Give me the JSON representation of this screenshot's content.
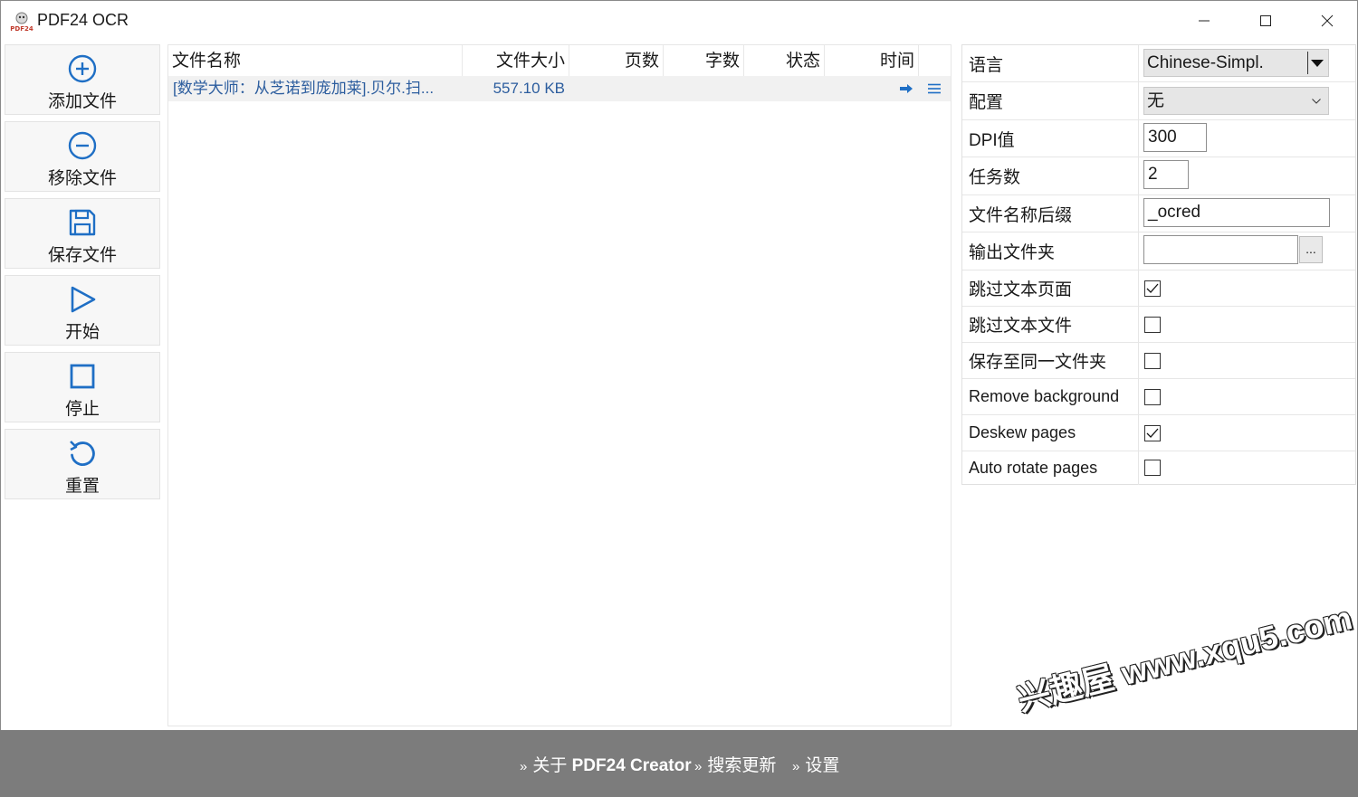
{
  "app": {
    "title": "PDF24 OCR"
  },
  "toolbar": {
    "add": "添加文件",
    "remove": "移除文件",
    "save": "保存文件",
    "start": "开始",
    "stop": "停止",
    "reset": "重置"
  },
  "filelist": {
    "columns": [
      "文件名称",
      "文件大小",
      "页数",
      "字数",
      "状态",
      "时间"
    ],
    "rows": [
      {
        "name": "[数学大师：从芝诺到庞加莱].贝尔.扫...",
        "size": "557.10 KB",
        "pages": "",
        "words": "",
        "status": "",
        "time": ""
      }
    ]
  },
  "settings": {
    "language_label": "语言",
    "language_value": "Chinese-Simpl.",
    "profile_label": "配置",
    "profile_value": "无",
    "dpi_label": "DPI值",
    "dpi_value": "300",
    "jobs_label": "任务数",
    "jobs_value": "2",
    "suffix_label": "文件名称后缀",
    "suffix_value": "_ocred",
    "outdir_label": "输出文件夹",
    "outdir_value": "",
    "browse_label": "...",
    "checkboxes": [
      {
        "label": "跳过文本页面",
        "checked": true
      },
      {
        "label": "跳过文本文件",
        "checked": false
      },
      {
        "label": "保存至同一文件夹",
        "checked": false
      },
      {
        "label": "Remove background",
        "checked": false
      },
      {
        "label": "Deskew pages",
        "checked": true
      },
      {
        "label": "Auto rotate pages",
        "checked": false
      }
    ]
  },
  "footer": {
    "about_prefix": "关于 ",
    "about_brand": "PDF24 Creator",
    "updates": "搜索更新",
    "settings": "设置"
  },
  "watermark": "兴趣屋 www.xqu5.com",
  "colors": {
    "accent_blue": "#1f6fc5",
    "file_text": "#2c5d9e",
    "footer_bg": "#7c7c7c"
  }
}
